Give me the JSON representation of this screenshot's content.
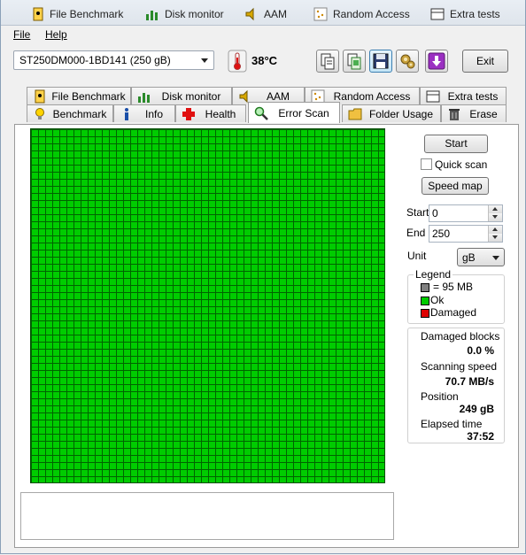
{
  "ghost_tabs": [
    "File Benchmark",
    "Disk monitor",
    "AAM",
    "Random Access",
    "Extra tests"
  ],
  "menu": {
    "file": "File",
    "help": "Help"
  },
  "toolbar": {
    "drive": "ST250DM000-1BD141 (250 gB)",
    "temperature": "38°C",
    "exit_label": "Exit"
  },
  "tabs_row1": [
    "File Benchmark",
    "Disk monitor",
    "AAM",
    "Random Access",
    "Extra tests"
  ],
  "tabs_row2": [
    "Benchmark",
    "Info",
    "Health",
    "Error Scan",
    "Folder Usage",
    "Erase"
  ],
  "error_scan": {
    "start_button": "Start",
    "quick_scan_label": "Quick scan",
    "quick_scan_checked": false,
    "speed_map_button": "Speed map",
    "start_label": "Start",
    "start_value": "0",
    "end_label": "End",
    "end_value": "250",
    "unit_label": "Unit",
    "unit_value": "gB",
    "grid": {
      "cells_ok_fraction": 1.0,
      "ok_color": "#00cc00",
      "cell_border_color": "#006400"
    },
    "legend": {
      "title": "Legend",
      "block_size": "= 95 MB",
      "ok": "Ok",
      "damaged": "Damaged",
      "colors": {
        "block": "#808080",
        "ok": "#00cc00",
        "damaged": "#dd0000"
      }
    },
    "stats": {
      "damaged_blocks_label": "Damaged blocks",
      "damaged_blocks_value": "0.0 %",
      "scanning_speed_label": "Scanning speed",
      "scanning_speed_value": "70.7 MB/s",
      "position_label": "Position",
      "position_value": "249 gB",
      "elapsed_label": "Elapsed time",
      "elapsed_value": "37:52"
    }
  }
}
